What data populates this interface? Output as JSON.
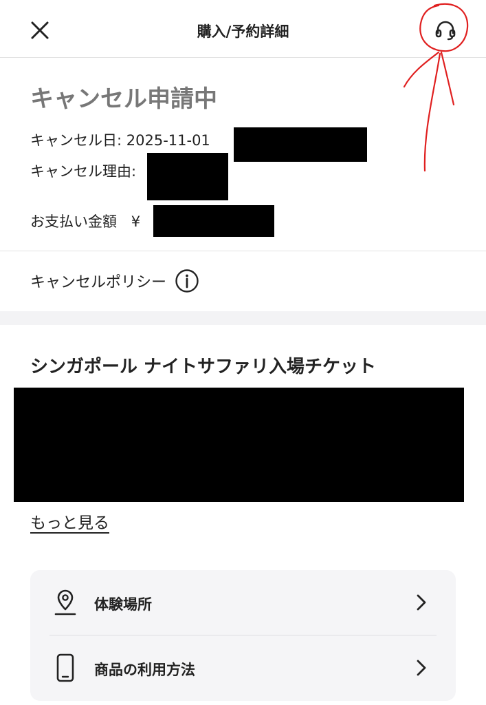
{
  "header": {
    "title": "購入/予約詳細",
    "close_icon": "close-icon",
    "support_icon": "headset-icon"
  },
  "status": {
    "title": "キャンセル申請中",
    "cancel_date_label": "キャンセル日: 2025-11-01",
    "cancel_reason_label": "キャンセル理由:",
    "payment_label": "お支払い金額",
    "payment_prefix": "¥"
  },
  "policy": {
    "label": "キャンセルポリシー",
    "icon": "info-icon"
  },
  "product": {
    "title": "シンガポール ナイトサファリ入場チケット",
    "more_link": "もっと見る"
  },
  "details_card": {
    "items": [
      {
        "label": "体験場所",
        "icon": "location-pin-icon"
      },
      {
        "label": "商品の利用方法",
        "icon": "smartphone-icon"
      }
    ]
  },
  "colors": {
    "status_title": "#777777",
    "annotation": "#e02020",
    "redaction": "#000000",
    "card_background": "#f5f5f7"
  }
}
